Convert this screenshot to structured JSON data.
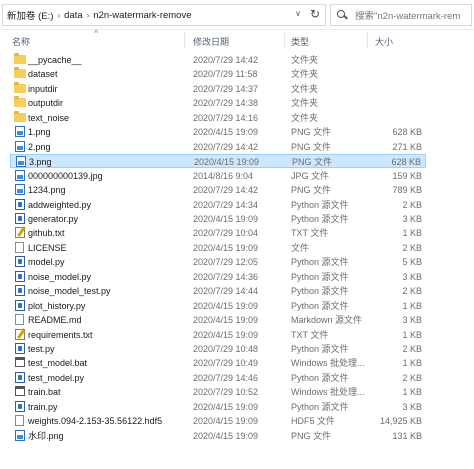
{
  "address_bar": {
    "breadcrumbs": [
      "新加卷 (E:)",
      "data",
      "n2n-watermark-remove"
    ],
    "separator": "›",
    "dropdown_icon": "chevron-down",
    "refresh_icon": "refresh"
  },
  "search": {
    "placeholder": "搜索\"n2n-watermark-rem"
  },
  "columns": {
    "name": "名称",
    "date": "修改日期",
    "type": "类型",
    "size": "大小",
    "sort_indicator": "^"
  },
  "files": [
    {
      "name": "__pycache__",
      "date": "2020/7/29 14:42",
      "type": "文件夹",
      "size": "",
      "icon": "folder"
    },
    {
      "name": "dataset",
      "date": "2020/7/29 11:58",
      "type": "文件夹",
      "size": "",
      "icon": "folder"
    },
    {
      "name": "inputdir",
      "date": "2020/7/29 14:37",
      "type": "文件夹",
      "size": "",
      "icon": "folder"
    },
    {
      "name": "outputdir",
      "date": "2020/7/29 14:38",
      "type": "文件夹",
      "size": "",
      "icon": "folder"
    },
    {
      "name": "text_noise",
      "date": "2020/7/29 14:16",
      "type": "文件夹",
      "size": "",
      "icon": "folder"
    },
    {
      "name": "1.png",
      "date": "2020/4/15 19:09",
      "type": "PNG 文件",
      "size": "628 KB",
      "icon": "image"
    },
    {
      "name": "2.png",
      "date": "2020/7/29 14:42",
      "type": "PNG 文件",
      "size": "271 KB",
      "icon": "image"
    },
    {
      "name": "3.png",
      "date": "2020/4/15 19:09",
      "type": "PNG 文件",
      "size": "628 KB",
      "icon": "image",
      "selected": true
    },
    {
      "name": "000000000139.jpg",
      "date": "2014/8/16 9:04",
      "type": "JPG 文件",
      "size": "159 KB",
      "icon": "image"
    },
    {
      "name": "1234.png",
      "date": "2020/7/29 14:42",
      "type": "PNG 文件",
      "size": "789 KB",
      "icon": "image"
    },
    {
      "name": "addweighted.py",
      "date": "2020/7/29 14:34",
      "type": "Python 源文件",
      "size": "2 KB",
      "icon": "python"
    },
    {
      "name": "generator.py",
      "date": "2020/4/15 19:09",
      "type": "Python 源文件",
      "size": "3 KB",
      "icon": "python"
    },
    {
      "name": "github.txt",
      "date": "2020/7/29 10:04",
      "type": "TXT 文件",
      "size": "1 KB",
      "icon": "text"
    },
    {
      "name": "LICENSE",
      "date": "2020/4/15 19:09",
      "type": "文件",
      "size": "2 KB",
      "icon": "document"
    },
    {
      "name": "model.py",
      "date": "2020/7/29 12:05",
      "type": "Python 源文件",
      "size": "5 KB",
      "icon": "python"
    },
    {
      "name": "noise_model.py",
      "date": "2020/7/29 14:36",
      "type": "Python 源文件",
      "size": "3 KB",
      "icon": "python"
    },
    {
      "name": "noise_model_test.py",
      "date": "2020/7/29 14:44",
      "type": "Python 源文件",
      "size": "2 KB",
      "icon": "python"
    },
    {
      "name": "plot_history.py",
      "date": "2020/4/15 19:09",
      "type": "Python 源文件",
      "size": "1 KB",
      "icon": "python"
    },
    {
      "name": "README.md",
      "date": "2020/4/15 19:09",
      "type": "Markdown 源文件",
      "size": "3 KB",
      "icon": "document"
    },
    {
      "name": "requirements.txt",
      "date": "2020/4/15 19:09",
      "type": "TXT 文件",
      "size": "1 KB",
      "icon": "text"
    },
    {
      "name": "test.py",
      "date": "2020/7/29 10:48",
      "type": "Python 源文件",
      "size": "2 KB",
      "icon": "python"
    },
    {
      "name": "test_model.bat",
      "date": "2020/7/29 10:49",
      "type": "Windows 批处理...",
      "size": "1 KB",
      "icon": "batch"
    },
    {
      "name": "test_model.py",
      "date": "2020/7/29 14:46",
      "type": "Python 源文件",
      "size": "2 KB",
      "icon": "python"
    },
    {
      "name": "train.bat",
      "date": "2020/7/29 10:52",
      "type": "Windows 批处理...",
      "size": "1 KB",
      "icon": "batch"
    },
    {
      "name": "train.py",
      "date": "2020/4/15 19:09",
      "type": "Python 源文件",
      "size": "3 KB",
      "icon": "python"
    },
    {
      "name": "weights.094-2.153-35.56122.hdf5",
      "date": "2020/4/15 19:09",
      "type": "HDF5 文件",
      "size": "14,925 KB",
      "icon": "document"
    },
    {
      "name": "水印.png",
      "date": "2020/4/15 19:09",
      "type": "PNG 文件",
      "size": "131 KB",
      "icon": "image"
    }
  ]
}
